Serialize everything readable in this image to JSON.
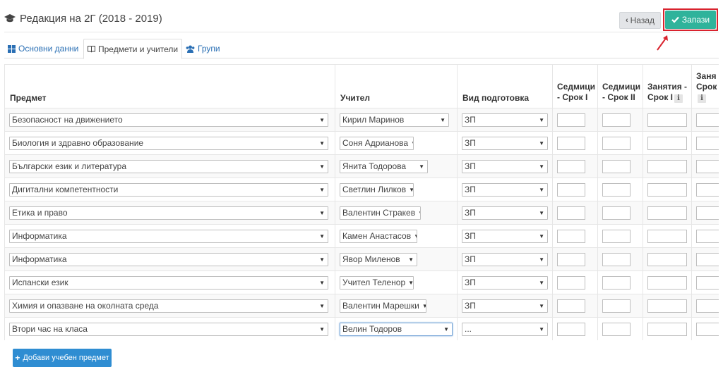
{
  "header": {
    "title": "Редакция на 2Г (2018 - 2019)",
    "icon": "graduation-cap-icon"
  },
  "toolbar": {
    "back_label": "Назад",
    "save_label": "Запази"
  },
  "tabs": [
    {
      "label": "Основни данни",
      "icon": "grid-icon"
    },
    {
      "label": "Предмети и учители",
      "icon": "book-icon"
    },
    {
      "label": "Групи",
      "icon": "users-icon"
    }
  ],
  "table": {
    "headers": {
      "subject": "Предмет",
      "teacher": "Учител",
      "prep_type": "Вид подготовка",
      "weeks_t1": "Седмици - Срок I",
      "weeks_t2": "Седмици - Срок II",
      "lessons_t1": "Занятия - Срок I",
      "lessons_t2": "Заня Срок"
    },
    "rows": [
      {
        "subject": "Безопасност на движението",
        "teacher": "Кирил Маринов",
        "prep": "ЗП"
      },
      {
        "subject": "Биология и здравно образование",
        "teacher": "Соня Адрианова",
        "prep": "ЗП"
      },
      {
        "subject": "Български език и литература",
        "teacher": "Янита Тодорова",
        "prep": "ЗП"
      },
      {
        "subject": "Дигитални компетентности",
        "teacher": "Светлин Лилков",
        "prep": "ЗП"
      },
      {
        "subject": "Етика и право",
        "teacher": "Валентин Стракев",
        "prep": "ЗП"
      },
      {
        "subject": "Информатика",
        "teacher": "Камен Анастасов",
        "prep": "ЗП"
      },
      {
        "subject": "Информатика",
        "teacher": "Явор Миленов",
        "prep": "ЗП"
      },
      {
        "subject": "Испански език",
        "teacher": "Учител Теленор",
        "prep": "ЗП"
      },
      {
        "subject": "Химия и опазване на околната среда",
        "teacher": "Валентин Марешки",
        "prep": "ЗП"
      },
      {
        "subject": "Втори час на класа",
        "teacher": "Велин Тодоров",
        "prep": "..."
      }
    ]
  },
  "add_button": {
    "label": "Добави учебен предмет"
  },
  "colors": {
    "save": "#2fb39b",
    "primary": "#2f8dd2",
    "highlight": "#d9232e"
  }
}
